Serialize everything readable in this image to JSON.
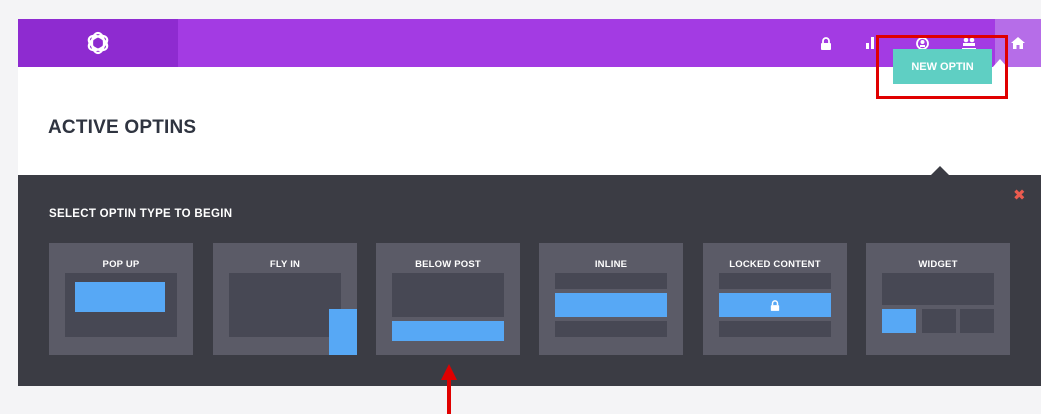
{
  "header": {
    "logo_icon": "bloom-logo-icon",
    "nav_icons": [
      "lock-icon",
      "stats-icon",
      "account-icon",
      "accounts-icon",
      "home-icon"
    ]
  },
  "main": {
    "title": "ACTIVE OPTINS",
    "new_button_label": "NEW OPTIN"
  },
  "panel": {
    "label": "SELECT OPTIN TYPE TO BEGIN",
    "close_icon": "close-icon",
    "cards": [
      {
        "label": "POP UP"
      },
      {
        "label": "FLY IN"
      },
      {
        "label": "BELOW POST"
      },
      {
        "label": "INLINE"
      },
      {
        "label": "LOCKED CONTENT"
      },
      {
        "label": "WIDGET"
      }
    ]
  },
  "colors": {
    "header": "#a33be3",
    "logo_block": "#8e2bd0",
    "button": "#5fcfc3",
    "panel": "#3b3c44",
    "card": "#5b5b67",
    "accent_blue": "#57a8f5",
    "annotation_red": "#e00000"
  }
}
